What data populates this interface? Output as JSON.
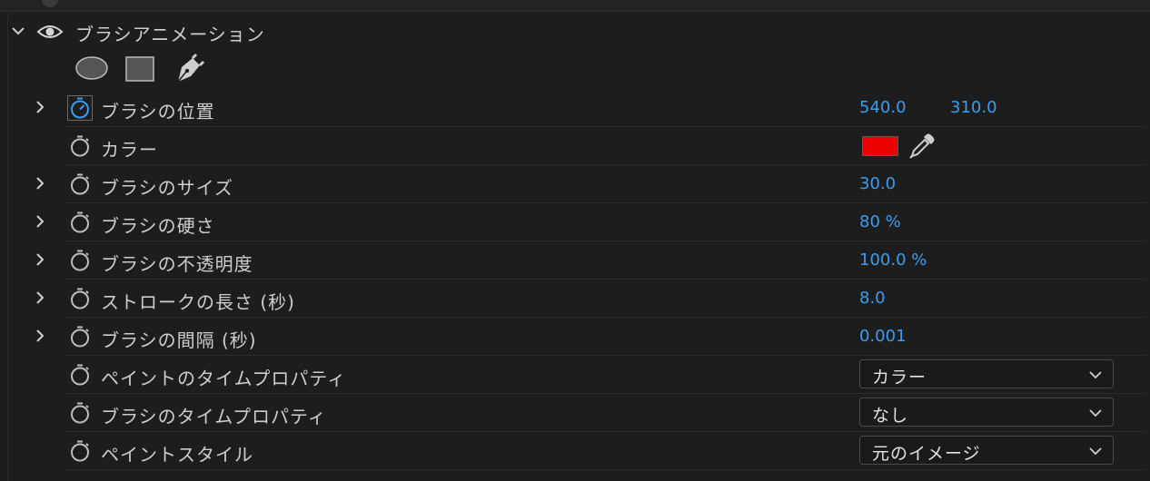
{
  "effect": {
    "title": "ブラシアニメーション"
  },
  "mask_tools": [
    "ellipse-mask-icon",
    "rectangle-mask-icon",
    "pen-mask-icon"
  ],
  "rows": [
    {
      "id": "brush-position",
      "label": "ブラシの位置",
      "expandable": true,
      "animated": true,
      "values": [
        "540.0",
        "310.0"
      ]
    },
    {
      "id": "color",
      "label": "カラー",
      "expandable": false,
      "color": "#ee0000"
    },
    {
      "id": "brush-size",
      "label": "ブラシのサイズ",
      "expandable": true,
      "values": [
        "30.0"
      ]
    },
    {
      "id": "brush-hardness",
      "label": "ブラシの硬さ",
      "expandable": true,
      "values": [
        "80 %"
      ]
    },
    {
      "id": "brush-opacity",
      "label": "ブラシの不透明度",
      "expandable": true,
      "values": [
        "100.0 %"
      ]
    },
    {
      "id": "stroke-length",
      "label": "ストロークの長さ (秒)",
      "expandable": true,
      "values": [
        "8.0"
      ]
    },
    {
      "id": "brush-spacing",
      "label": "ブラシの間隔 (秒)",
      "expandable": true,
      "values": [
        "0.001"
      ]
    },
    {
      "id": "paint-time-props",
      "label": "ペイントのタイムプロパティ",
      "expandable": false,
      "select": "カラー"
    },
    {
      "id": "brush-time-props",
      "label": "ブラシのタイムプロパティ",
      "expandable": false,
      "select": "なし"
    },
    {
      "id": "paint-style",
      "label": "ペイントスタイル",
      "expandable": false,
      "select": "元のイメージ"
    }
  ],
  "colors": {
    "accent": "#3b9cf0",
    "background": "#1d1d1d",
    "swatch": "#ee0000"
  }
}
